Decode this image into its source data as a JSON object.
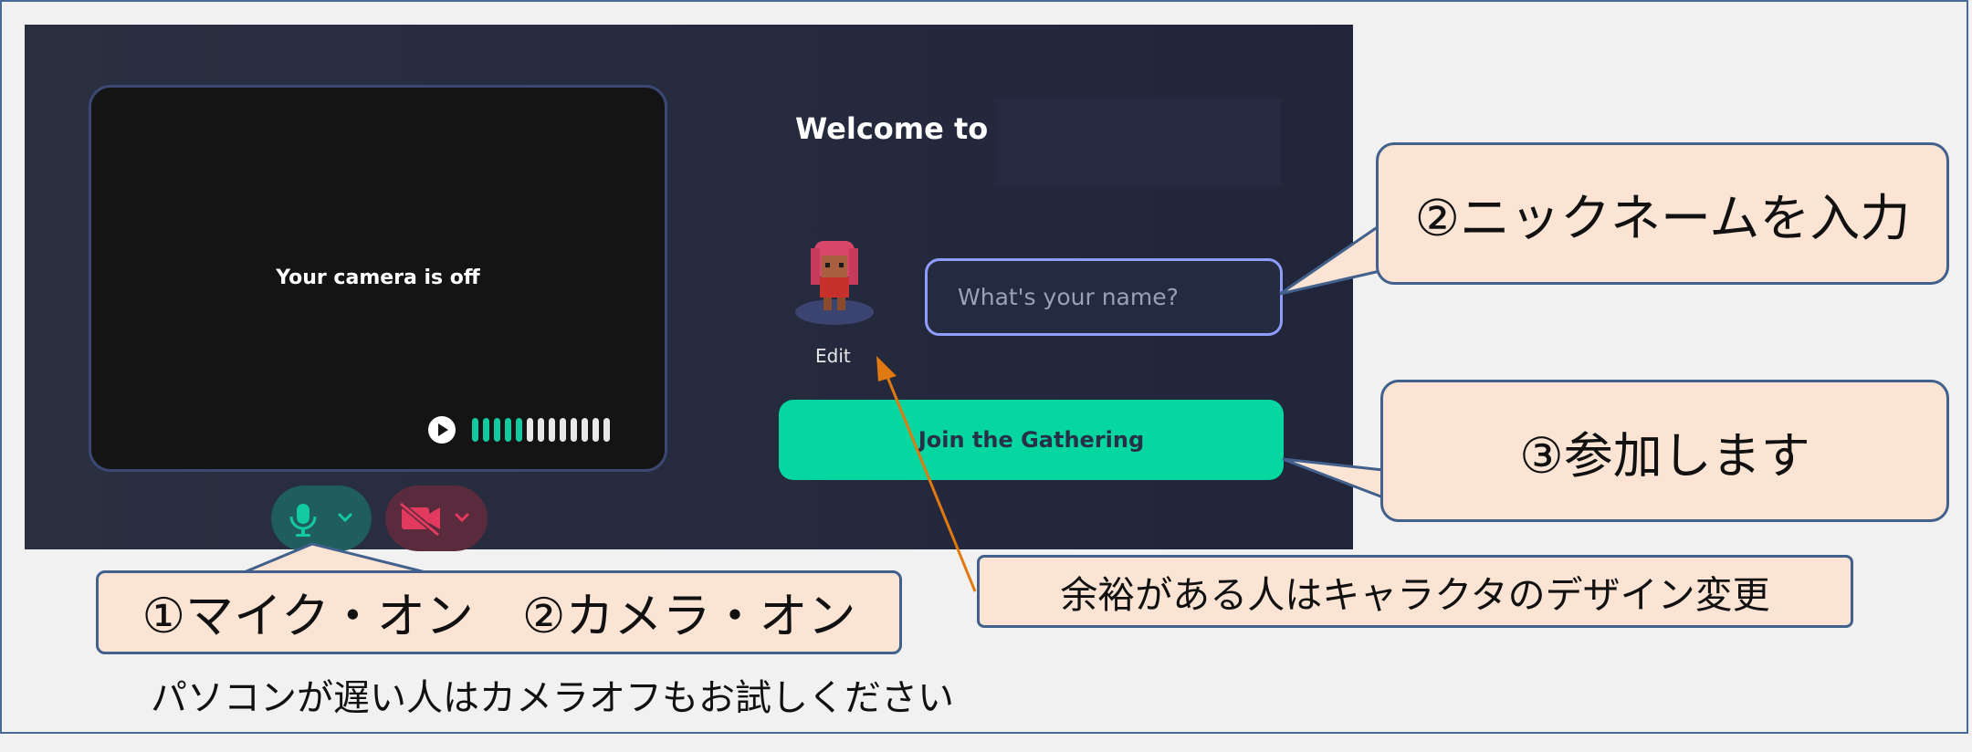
{
  "app": {
    "camera_status": "Your camera is off",
    "welcome_text": "Welcome to",
    "avatar_edit_label": "Edit",
    "name_input": {
      "placeholder": "What's your name?",
      "value": ""
    },
    "join_button_label": "Join the Gathering",
    "mic_control": {
      "icon": "microphone-icon",
      "dropdown_icon": "chevron-down-icon",
      "state": "on",
      "color": "#13c9a0"
    },
    "camera_control": {
      "icon": "video-off-icon",
      "dropdown_icon": "chevron-down-icon",
      "state": "off",
      "color": "#e23a5e"
    },
    "audio_meter": {
      "icon": "play-icon",
      "total_bars": 13,
      "active_bars": 5
    },
    "accent_color": "#06d6a0"
  },
  "annotations": {
    "nickname_callout": "②ニックネームを入力",
    "join_callout": "③参加します",
    "mic_camera_callout": "①マイク・オン　②カメラ・オン",
    "design_callout": "余裕がある人はキャラクタのデザイン変更",
    "slow_pc_note": "パソコンが遅い人はカメラオフもお試しください"
  }
}
